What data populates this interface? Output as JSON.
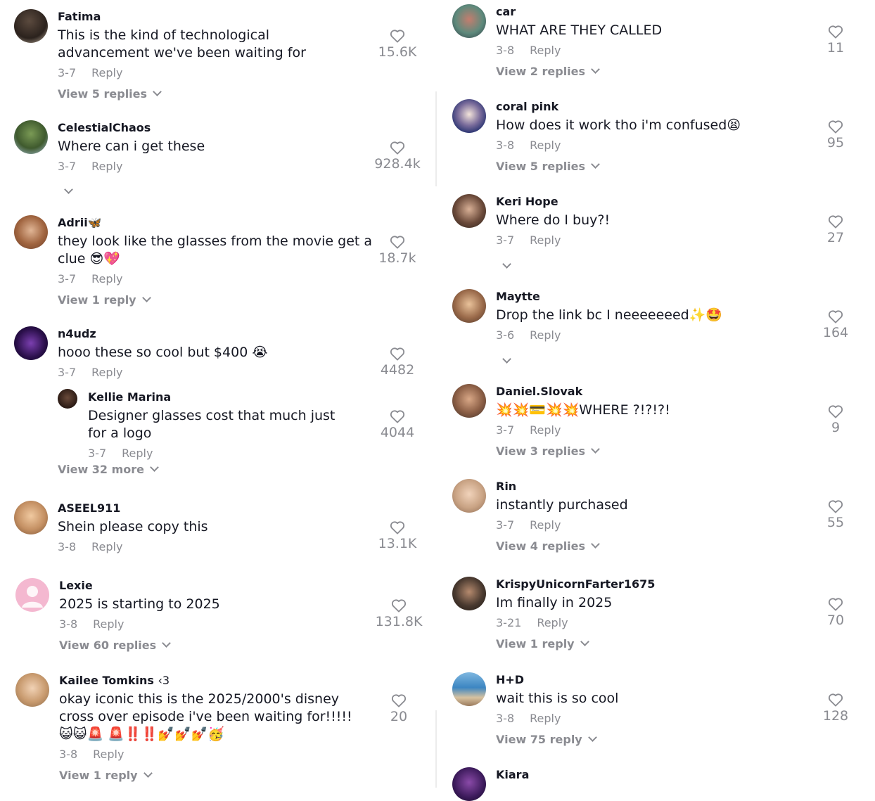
{
  "left": [
    {
      "user": "Fatima",
      "text": "This is the kind of technological advancement we've been waiting for",
      "date": "3-7",
      "reply": "Reply",
      "likes": "15.6K",
      "view": "View 5 replies"
    },
    {
      "user": "CelestialChaos",
      "text": "Where can i get these",
      "date": "3-7",
      "reply": "Reply",
      "likes": "928.4k"
    },
    {
      "user": "Adrii🦋",
      "text": "they look like the glasses from the movie get a clue 😎💖",
      "date": "3-7",
      "reply": "Reply",
      "likes": "18.7k",
      "view": "View 1 reply"
    },
    {
      "user": "n4udz",
      "text": "hooo these so cool but $400 😭",
      "date": "3-7",
      "reply": "Reply",
      "likes": "4482",
      "subreply": {
        "user": "Kellie Marina",
        "text": "Designer glasses cost that much just for a logo",
        "date": "3-7",
        "reply": "Reply",
        "likes": "4044"
      },
      "view": "View 32 more"
    },
    {
      "user": "ASEEL911",
      "text": "Shein please copy this",
      "date": "3-8",
      "reply": "Reply",
      "likes": "13.1K"
    },
    {
      "user": "Lexie",
      "text": "2025 is starting to 2025",
      "date": "3-8",
      "reply": "Reply",
      "likes": "131.8K",
      "view": "View 60 replies"
    },
    {
      "user": "Kailee Tomkins",
      "badge": "‹3",
      "text": "okay iconic this is the 2025/2000's disney cross over episode i've been waiting for!!!!!😺😺🚨 🚨‼️‼️💅💅💅🥳",
      "date": "3-8",
      "reply": "Reply",
      "likes": "20",
      "view": "View 1 reply"
    }
  ],
  "right": [
    {
      "user": "car",
      "text": "WHAT ARE THEY CALLED",
      "date": "3-8",
      "reply": "Reply",
      "likes": "11",
      "view": "View 2 replies"
    },
    {
      "user": "coral pink",
      "text": "How does it work tho i'm confused😫",
      "date": "3-8",
      "reply": "Reply",
      "likes": "95",
      "view": "View 5 replies"
    },
    {
      "user": "Keri Hope",
      "text": "Where do I buy?!",
      "date": "3-7",
      "reply": "Reply",
      "likes": "27"
    },
    {
      "user": "Maytte",
      "text": "Drop the link bc I neeeeeeed✨🤩",
      "date": "3-6",
      "reply": "Reply",
      "likes": "164"
    },
    {
      "user": "Daniel.Slovak",
      "text": "💥💥💳💥💥WHERE ?!?!?!",
      "date": "3-7",
      "reply": "Reply",
      "likes": "9",
      "view": "View 3 replies"
    },
    {
      "user": "Rin",
      "text": "instantly purchased",
      "date": "3-7",
      "reply": "Reply",
      "likes": "55",
      "view": "View 4 replies"
    },
    {
      "user": "KrispyUnicornFarter1675",
      "text": "Im finally in 2025",
      "date": "3-21",
      "reply": "Reply",
      "likes": "70",
      "view": "View 1 reply"
    },
    {
      "user": "H+D",
      "text": "wait this is so cool",
      "date": "3-8",
      "reply": "Reply",
      "likes": "128",
      "view": "View 75 reply"
    },
    {
      "user": "Kiara"
    }
  ],
  "colors": {
    "text": "#161823",
    "muted": "#8a8b91",
    "divider": "#ececec"
  },
  "icons": {
    "like": "heart-outline-icon",
    "expand": "chevron-down-icon",
    "avatar": "user-avatar"
  }
}
